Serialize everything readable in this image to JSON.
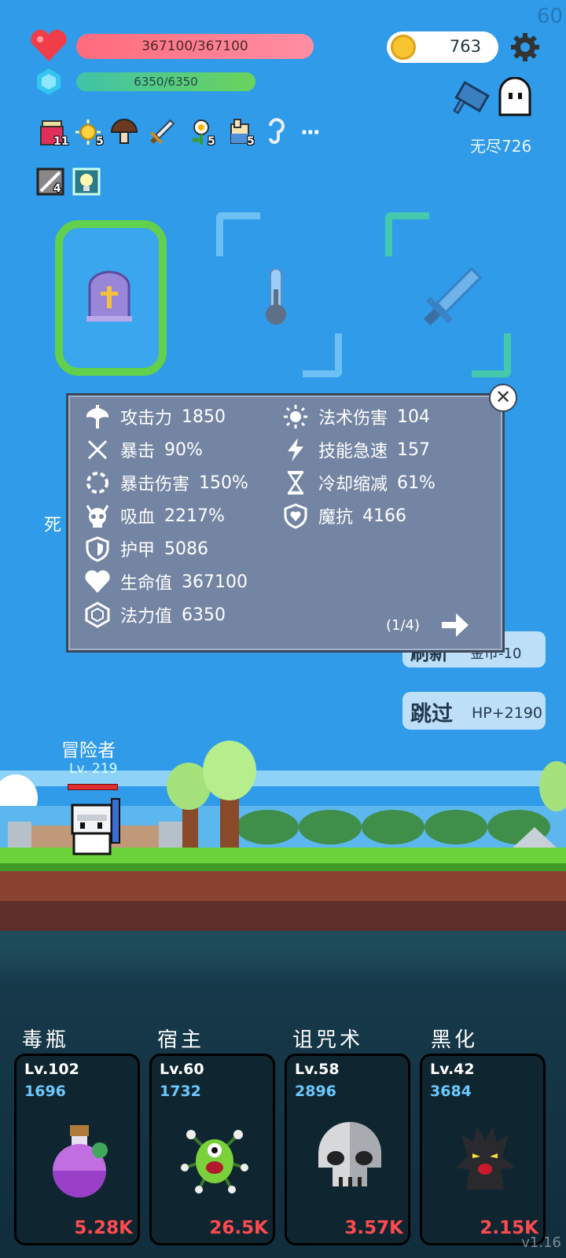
{
  "fps": "60",
  "player": {
    "hp_text": "367100/367100",
    "hp_fraction": 1.0,
    "mp_text": "6350/6350",
    "mp_fraction": 1.0
  },
  "coins": "763",
  "endless_label": "无尽726",
  "buffs": [
    {
      "icon": "jam-jar-icon",
      "count": "11"
    },
    {
      "icon": "sun-burst-icon",
      "count": "5"
    },
    {
      "icon": "mushroom-icon",
      "count": ""
    },
    {
      "icon": "sword-icon",
      "count": ""
    },
    {
      "icon": "flower-icon",
      "count": "5"
    },
    {
      "icon": "scroll-icon",
      "count": "5"
    },
    {
      "icon": "hook-icon",
      "count": ""
    },
    {
      "icon": "more-icon",
      "count": "···"
    }
  ],
  "buffs_row2": [
    {
      "icon": "sword-slash-icon",
      "count": "4"
    },
    {
      "icon": "lightbulb-icon",
      "count": ""
    }
  ],
  "stats": {
    "left": [
      {
        "icon": "axe-icon",
        "label": "攻击力",
        "value": "1850"
      },
      {
        "icon": "crit-cross-icon",
        "label": "暴击",
        "value": "90%"
      },
      {
        "icon": "crit-ring-icon",
        "label": "暴击伤害",
        "value": "150%"
      },
      {
        "icon": "skull-horn-icon",
        "label": "吸血",
        "value": "2217%"
      },
      {
        "icon": "shield-icon",
        "label": "护甲",
        "value": "5086"
      },
      {
        "icon": "heart-icon",
        "label": "生命值",
        "value": "367100"
      },
      {
        "icon": "crystal-icon",
        "label": "法力值",
        "value": "6350"
      }
    ],
    "right": [
      {
        "icon": "sun-icon",
        "label": "法术伤害",
        "value": "104"
      },
      {
        "icon": "lightning-icon",
        "label": "技能急速",
        "value": "157"
      },
      {
        "icon": "hourglass-icon",
        "label": "冷却缩减",
        "value": "61%"
      },
      {
        "icon": "magic-shield-icon",
        "label": "魔抗",
        "value": "4166"
      }
    ],
    "page": "(1/4)"
  },
  "buttons": {
    "refresh_label": "刷新",
    "refresh_cost": "金币-10",
    "skip_label": "跳过",
    "skip_reward": "HP+2190"
  },
  "death_label": "死",
  "hero": {
    "name": "冒险者",
    "level": "Lv. 219"
  },
  "skills": [
    {
      "title": "毒瓶",
      "level": "Lv.102",
      "power": "1696",
      "damage": "5.28K",
      "icon": "poison-bottle-icon"
    },
    {
      "title": "宿主",
      "level": "Lv.60",
      "power": "1732",
      "damage": "26.5K",
      "icon": "green-monster-icon"
    },
    {
      "title": "诅咒术",
      "level": "Lv.58",
      "power": "2896",
      "damage": "3.57K",
      "icon": "skull-icon"
    },
    {
      "title": "黑化",
      "level": "Lv.42",
      "power": "3684",
      "damage": "2.15K",
      "icon": "dark-tree-icon"
    }
  ],
  "version": "v1.16",
  "colors": {
    "sky": "#2f9be9",
    "hp": "#ff6b7c",
    "mp": "#4fc98a",
    "select": "#62d04d",
    "damage": "#ff4b50",
    "power": "#6cc8ff"
  }
}
